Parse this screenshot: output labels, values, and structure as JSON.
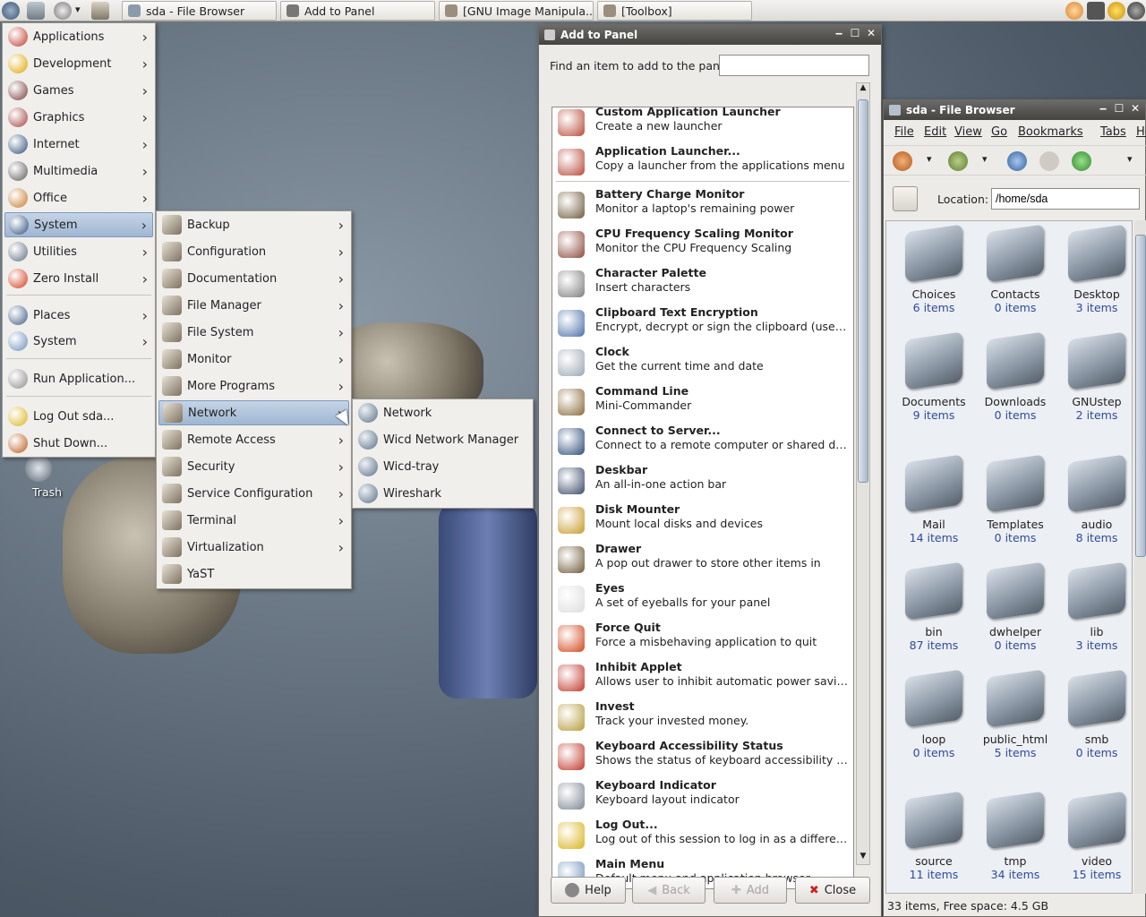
{
  "colors": {
    "accent": "#9fb6d2",
    "titlebar": "#45443f",
    "link": "#2f4a9c"
  },
  "taskbar": {
    "tasks": [
      {
        "label": "sda - File Browser",
        "icon": "folder-icon"
      },
      {
        "label": "Add to Panel",
        "icon": "panel-icon"
      },
      {
        "label": "[GNU Image Manipula...",
        "icon": "gimp-icon"
      },
      {
        "label": "[Toolbox]",
        "icon": "gimp-icon"
      }
    ]
  },
  "desktop": {
    "trash_label": "Trash"
  },
  "main_menu": {
    "items": [
      {
        "label": "Applications",
        "icon": "applications-icon",
        "sub": true
      },
      {
        "label": "Development",
        "icon": "development-icon",
        "sub": true
      },
      {
        "label": "Games",
        "icon": "games-icon",
        "sub": true
      },
      {
        "label": "Graphics",
        "icon": "graphics-icon",
        "sub": true
      },
      {
        "label": "Internet",
        "icon": "internet-icon",
        "sub": true
      },
      {
        "label": "Multimedia",
        "icon": "multimedia-icon",
        "sub": true
      },
      {
        "label": "Office",
        "icon": "office-icon",
        "sub": true
      },
      {
        "label": "System",
        "icon": "system-icon",
        "sub": true,
        "selected": true
      },
      {
        "label": "Utilities",
        "icon": "utilities-icon",
        "sub": true
      },
      {
        "label": "Zero Install",
        "icon": "zero-install-icon",
        "sub": true
      },
      {
        "label": "Places",
        "icon": "places-icon",
        "sub": true
      },
      {
        "label": "System",
        "icon": "system-settings-icon",
        "sub": true
      },
      {
        "label": "Run Application...",
        "icon": "run-icon",
        "sub": false
      },
      {
        "label": "Log Out sda...",
        "icon": "logout-icon",
        "sub": false
      },
      {
        "label": "Shut Down...",
        "icon": "shutdown-icon",
        "sub": false
      }
    ]
  },
  "system_menu": {
    "items": [
      {
        "label": "Backup",
        "sub": true
      },
      {
        "label": "Configuration",
        "sub": true
      },
      {
        "label": "Documentation",
        "sub": true
      },
      {
        "label": "File Manager",
        "sub": true
      },
      {
        "label": "File System",
        "sub": true
      },
      {
        "label": "Monitor",
        "sub": true
      },
      {
        "label": "More Programs",
        "sub": true
      },
      {
        "label": "Network",
        "sub": true,
        "selected": true
      },
      {
        "label": "Remote Access",
        "sub": true
      },
      {
        "label": "Security",
        "sub": true
      },
      {
        "label": "Service Configuration",
        "sub": true
      },
      {
        "label": "Terminal",
        "sub": true
      },
      {
        "label": "Virtualization",
        "sub": true
      },
      {
        "label": "YaST",
        "sub": false
      }
    ]
  },
  "network_menu": {
    "items": [
      {
        "label": "Network"
      },
      {
        "label": "Wicd Network Manager"
      },
      {
        "label": "Wicd-tray"
      },
      {
        "label": "Wireshark"
      }
    ]
  },
  "add_panel": {
    "title": "Add to Panel",
    "find_label": "Find an item to add to the panel:",
    "find_value": "",
    "items": [
      {
        "title": "Custom Application Launcher",
        "desc": "Create a new launcher"
      },
      {
        "title": "Application Launcher...",
        "desc": "Copy a launcher from the applications menu"
      },
      {
        "title": "Battery Charge Monitor",
        "desc": "Monitor a laptop's remaining power"
      },
      {
        "title": "CPU Frequency Scaling Monitor",
        "desc": "Monitor the CPU Frequency Scaling"
      },
      {
        "title": "Character Palette",
        "desc": "Insert characters"
      },
      {
        "title": "Clipboard Text Encryption",
        "desc": "Encrypt, decrypt or sign the clipboard (uses PGP ..."
      },
      {
        "title": "Clock",
        "desc": "Get the current time and date"
      },
      {
        "title": "Command Line",
        "desc": "Mini-Commander"
      },
      {
        "title": "Connect to Server...",
        "desc": "Connect to a remote computer or shared disk"
      },
      {
        "title": "Deskbar",
        "desc": "An all-in-one action bar"
      },
      {
        "title": "Disk Mounter",
        "desc": "Mount local disks and devices"
      },
      {
        "title": "Drawer",
        "desc": "A pop out drawer to store other items in"
      },
      {
        "title": "Eyes",
        "desc": "A set of eyeballs for your panel"
      },
      {
        "title": "Force Quit",
        "desc": "Force a misbehaving application to quit"
      },
      {
        "title": "Inhibit Applet",
        "desc": "Allows user to inhibit automatic power saving"
      },
      {
        "title": "Invest",
        "desc": "Track your invested money."
      },
      {
        "title": "Keyboard Accessibility Status",
        "desc": "Shows the status of keyboard accessibility featu..."
      },
      {
        "title": "Keyboard Indicator",
        "desc": "Keyboard layout indicator"
      },
      {
        "title": "Log Out...",
        "desc": "Log out of this session to log in as a different user"
      },
      {
        "title": "Main Menu",
        "desc": "Default menu and application browser"
      }
    ],
    "buttons": {
      "help": "Help",
      "back": "Back",
      "add": "Add",
      "close": "Close"
    }
  },
  "file_browser": {
    "title": "sda - File Browser",
    "menu": [
      "File",
      "Edit",
      "View",
      "Go",
      "Bookmarks",
      "Tabs",
      "Help"
    ],
    "location_label": "Location:",
    "location_value": "/home/sda",
    "status": "33 items, Free space: 4.5 GB",
    "folders": [
      {
        "name": "Choices",
        "count": "6 items"
      },
      {
        "name": "Contacts",
        "count": "0 items"
      },
      {
        "name": "Desktop",
        "count": "3 items"
      },
      {
        "name": "Documents",
        "count": "9 items"
      },
      {
        "name": "Downloads",
        "count": "0 items"
      },
      {
        "name": "GNUstep",
        "count": "2 items"
      },
      {
        "name": "Mail",
        "count": "14 items"
      },
      {
        "name": "Templates",
        "count": "0 items"
      },
      {
        "name": "audio",
        "count": "8 items"
      },
      {
        "name": "bin",
        "count": "87 items"
      },
      {
        "name": "dwhelper",
        "count": "0 items"
      },
      {
        "name": "lib",
        "count": "3 items"
      },
      {
        "name": "loop",
        "count": "0 items"
      },
      {
        "name": "public_html",
        "count": "5 items"
      },
      {
        "name": "smb",
        "count": "0 items"
      },
      {
        "name": "source",
        "count": "11 items"
      },
      {
        "name": "tmp",
        "count": "34 items"
      },
      {
        "name": "video",
        "count": "15 items"
      }
    ]
  }
}
